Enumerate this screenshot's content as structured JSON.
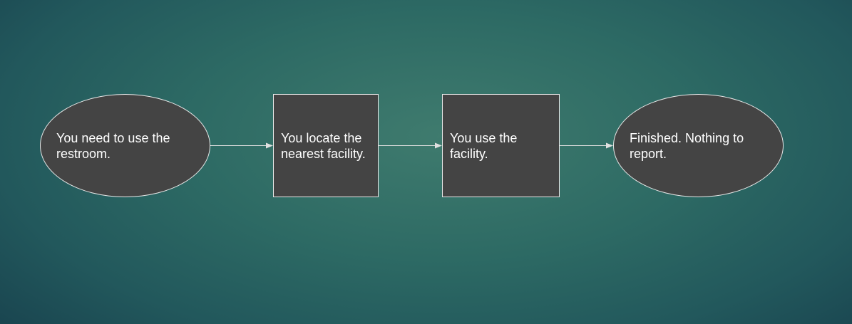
{
  "flowchart": {
    "nodes": [
      {
        "id": "start",
        "shape": "terminal",
        "label": "You need to use the\nrestroom."
      },
      {
        "id": "locate",
        "shape": "process",
        "label": "You locate the\nnearest facility."
      },
      {
        "id": "use",
        "shape": "process",
        "label": "You use the\nfacility."
      },
      {
        "id": "finish",
        "shape": "terminal",
        "label": "Finished.  Nothing to\nreport."
      }
    ],
    "edges": [
      {
        "from": "start",
        "to": "locate"
      },
      {
        "from": "locate",
        "to": "use"
      },
      {
        "from": "use",
        "to": "finish"
      }
    ],
    "colors": {
      "node_fill": "#444444",
      "node_border": "#e8e8e8",
      "text": "#ffffff",
      "connector": "#e0e0e0",
      "background_center": "#3f7b6e",
      "background_edge": "#173f4c"
    }
  }
}
